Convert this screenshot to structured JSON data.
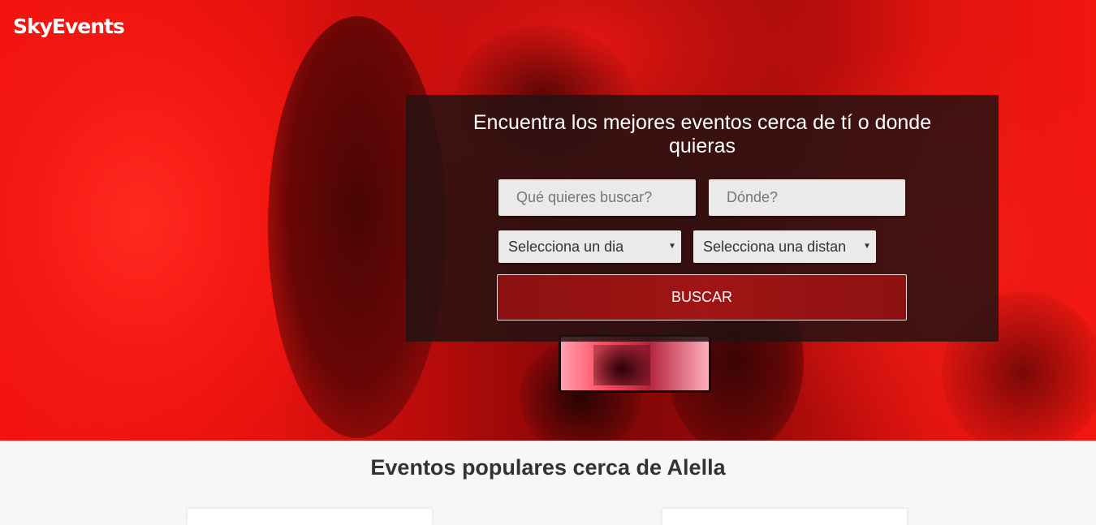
{
  "brand": {
    "logo_text": "SkyEvents"
  },
  "search": {
    "title": "Encuentra los mejores eventos cerca de tí o donde quieras",
    "what_placeholder": "Qué quieres buscar?",
    "where_placeholder": "Dónde?",
    "day_select": {
      "selected": "Selecciona un dia"
    },
    "distance_select": {
      "selected": "Selecciona una distan"
    },
    "submit_label": "BUSCAR"
  },
  "popular": {
    "title": "Eventos populares cerca de Alella"
  },
  "colors": {
    "accent": "#a01515",
    "hero_red": "#f3130f",
    "panel": "#231212"
  }
}
